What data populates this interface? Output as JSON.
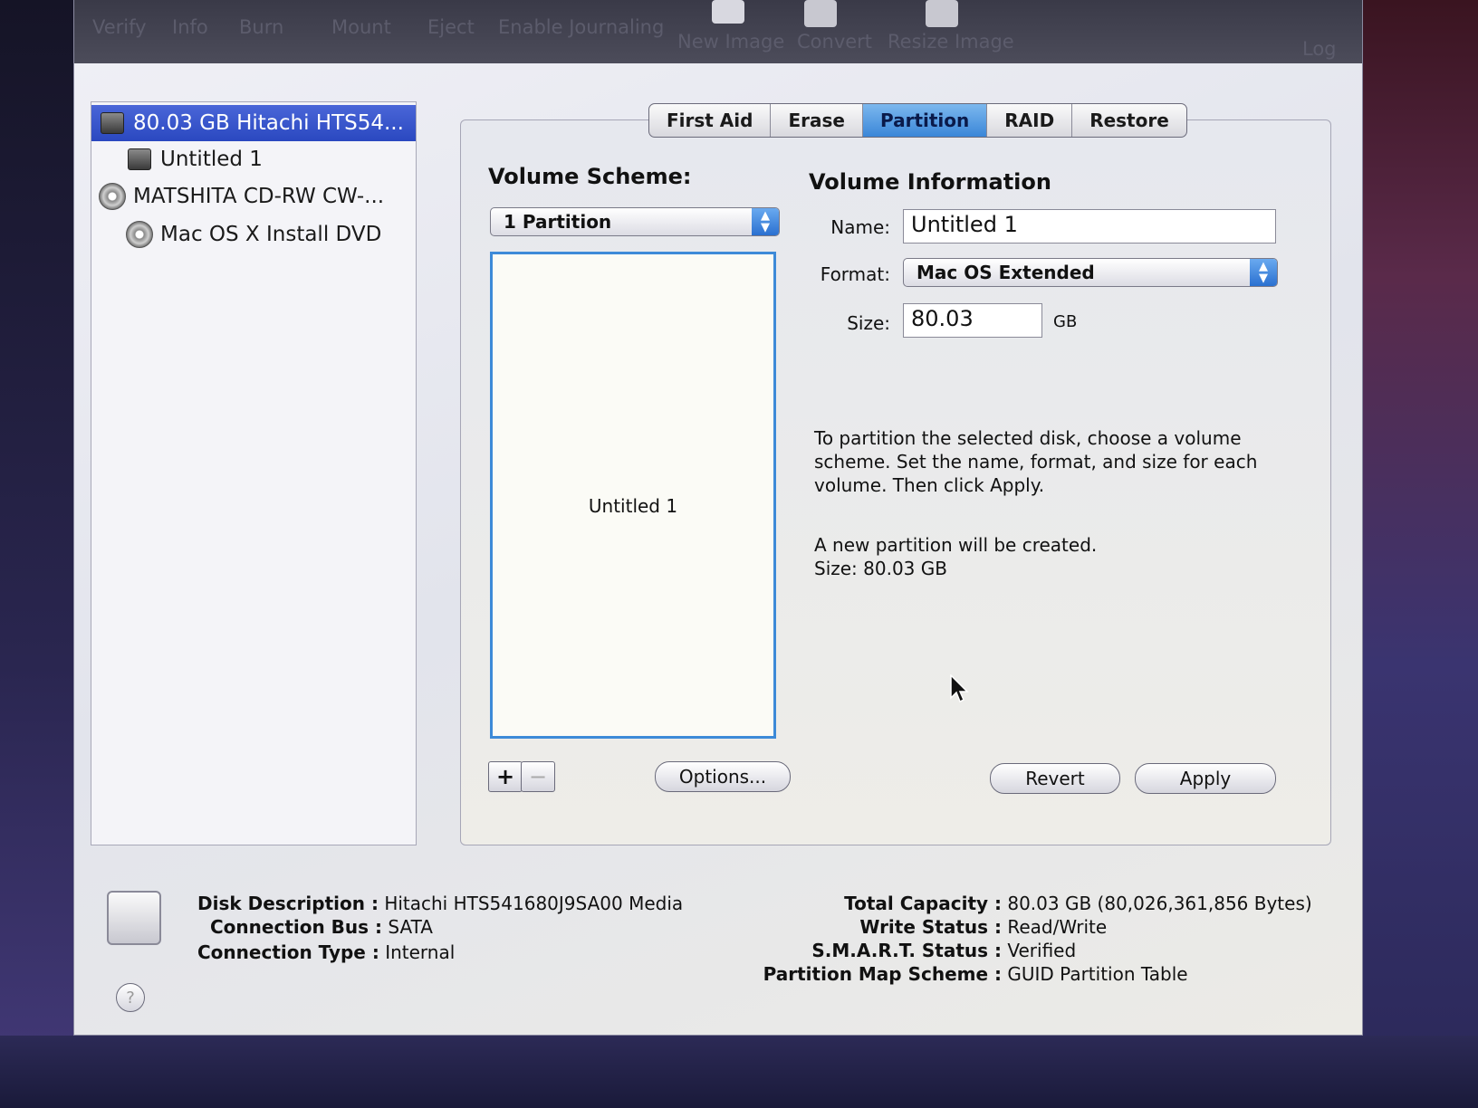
{
  "toolbar": {
    "items": [
      "Verify",
      "Info",
      "Burn",
      "Mount",
      "Eject",
      "Enable Journaling",
      "New Image",
      "Convert",
      "Resize Image",
      "Log"
    ]
  },
  "sidebar": {
    "items": [
      {
        "label": "80.03 GB Hitachi HTS54...",
        "icon": "hard-disk-icon",
        "selected": true
      },
      {
        "label": "Untitled 1",
        "icon": "volume-icon",
        "selected": false
      },
      {
        "label": "MATSHITA CD-RW CW-...",
        "icon": "optical-drive-icon",
        "selected": false
      },
      {
        "label": "Mac OS X Install DVD",
        "icon": "dvd-icon",
        "selected": false
      }
    ]
  },
  "tabs": [
    "First Aid",
    "Erase",
    "Partition",
    "RAID",
    "Restore"
  ],
  "active_tab": "Partition",
  "volume_scheme": {
    "heading": "Volume Scheme:",
    "selected": "1 Partition",
    "partition_label": "Untitled 1",
    "add_symbol": "+",
    "remove_symbol": "−",
    "options_label": "Options..."
  },
  "volume_info": {
    "heading": "Volume Information",
    "name_label": "Name:",
    "name_value": "Untitled 1",
    "format_label": "Format:",
    "format_value": "Mac OS Extended",
    "size_label": "Size:",
    "size_value": "80.03",
    "size_unit": "GB",
    "help_text": "To partition the selected disk, choose a volume scheme. Set the name, format, and size for each volume. Then click Apply.",
    "status_line1": "A new partition will be created.",
    "status_line2": "Size: 80.03 GB"
  },
  "buttons": {
    "revert": "Revert",
    "apply": "Apply"
  },
  "disk_info": {
    "left": [
      {
        "key": "Disk Description :",
        "value": "Hitachi HTS541680J9SA00 Media"
      },
      {
        "key": "Connection Bus :",
        "value": "SATA"
      },
      {
        "key": "Connection Type :",
        "value": "Internal"
      }
    ],
    "right": [
      {
        "key": "Total Capacity :",
        "value": "80.03 GB (80,026,361,856 Bytes)"
      },
      {
        "key": "Write Status :",
        "value": "Read/Write"
      },
      {
        "key": "S.M.A.R.T. Status :",
        "value": "Verified"
      },
      {
        "key": "Partition Map Scheme :",
        "value": "GUID Partition Table"
      }
    ]
  },
  "help_button": "?",
  "colors": {
    "selection": "#2a48c0",
    "active_tab": "#3a86d8",
    "partition_border": "#3d8ad8"
  }
}
